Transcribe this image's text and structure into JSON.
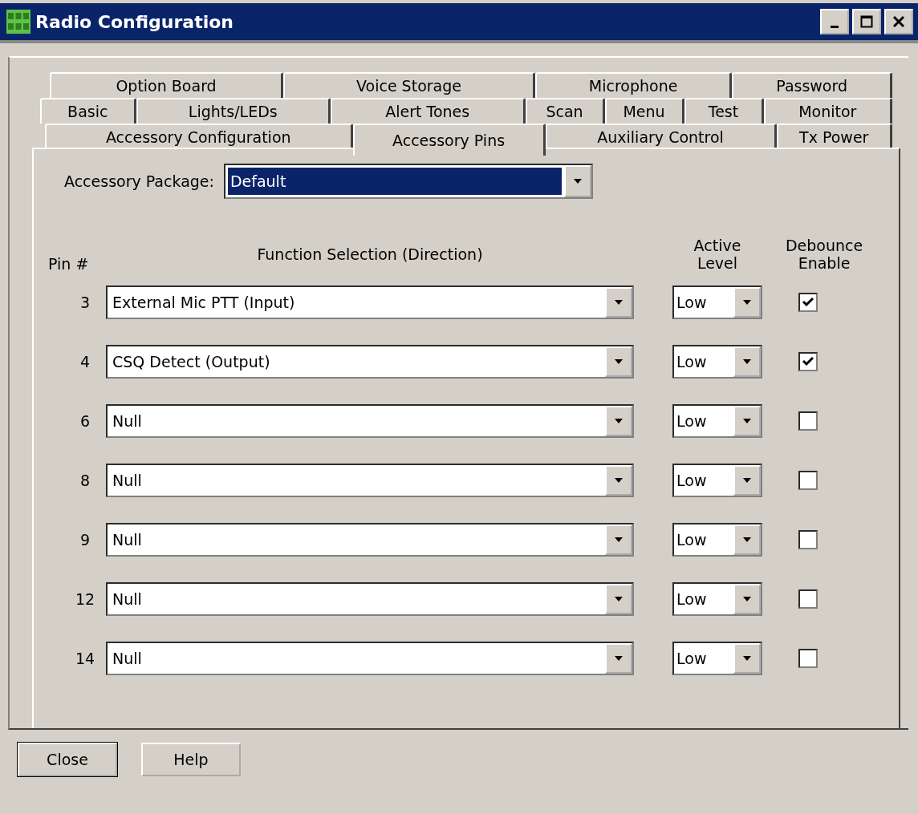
{
  "window": {
    "title": "Radio Configuration"
  },
  "tab_rows": [
    [
      {
        "label": "Option Board",
        "selected": false
      },
      {
        "label": "Voice Storage",
        "selected": false
      },
      {
        "label": "Microphone",
        "selected": false
      },
      {
        "label": "Password",
        "selected": false
      }
    ],
    [
      {
        "label": "Basic",
        "selected": false
      },
      {
        "label": "Lights/LEDs",
        "selected": false
      },
      {
        "label": "Alert Tones",
        "selected": false
      },
      {
        "label": "Scan",
        "selected": false
      },
      {
        "label": "Menu",
        "selected": false
      },
      {
        "label": "Test",
        "selected": false
      },
      {
        "label": "Monitor",
        "selected": false
      }
    ],
    [
      {
        "label": "Accessory Configuration",
        "selected": false
      },
      {
        "label": "Accessory Pins",
        "selected": true
      },
      {
        "label": "Auxiliary Control",
        "selected": false
      },
      {
        "label": "Tx Power",
        "selected": false
      }
    ]
  ],
  "accessory_package": {
    "label": "Accessory Package:",
    "value": "Default",
    "focused": true
  },
  "columns": {
    "pin": "Pin #",
    "function": "Function Selection (Direction)",
    "active_level": "Active Level",
    "debounce": "Debounce Enable"
  },
  "pins": [
    {
      "pin": "3",
      "function": "External Mic PTT (Input)",
      "active_level": "Low",
      "debounce": true
    },
    {
      "pin": "4",
      "function": "CSQ Detect (Output)",
      "active_level": "Low",
      "debounce": true
    },
    {
      "pin": "6",
      "function": "Null",
      "active_level": "Low",
      "debounce": false
    },
    {
      "pin": "8",
      "function": "Null",
      "active_level": "Low",
      "debounce": false
    },
    {
      "pin": "9",
      "function": "Null",
      "active_level": "Low",
      "debounce": false
    },
    {
      "pin": "12",
      "function": "Null",
      "active_level": "Low",
      "debounce": false
    },
    {
      "pin": "14",
      "function": "Null",
      "active_level": "Low",
      "debounce": false
    }
  ],
  "buttons": [
    "Close",
    "Help"
  ]
}
